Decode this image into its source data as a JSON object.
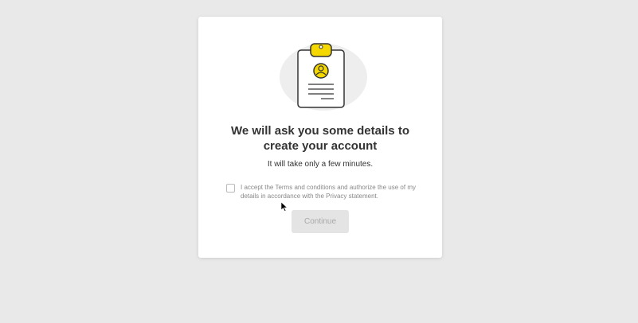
{
  "card": {
    "title_line1": "We will ask you some details to",
    "title_line2": "create your account",
    "subtitle": "It will take only a few minutes."
  },
  "consent": {
    "checked": false,
    "text": "I accept the Terms and conditions and authorize the use of my details in accordance with the Privacy statement."
  },
  "buttons": {
    "continue_label": "Continue",
    "continue_enabled": false
  },
  "illustration": {
    "icon": "clipboard-user-icon",
    "accent_color": "#f5d800"
  },
  "colors": {
    "background": "#e9e9e9",
    "card": "#ffffff",
    "disabled_button": "#e4e4e4"
  }
}
